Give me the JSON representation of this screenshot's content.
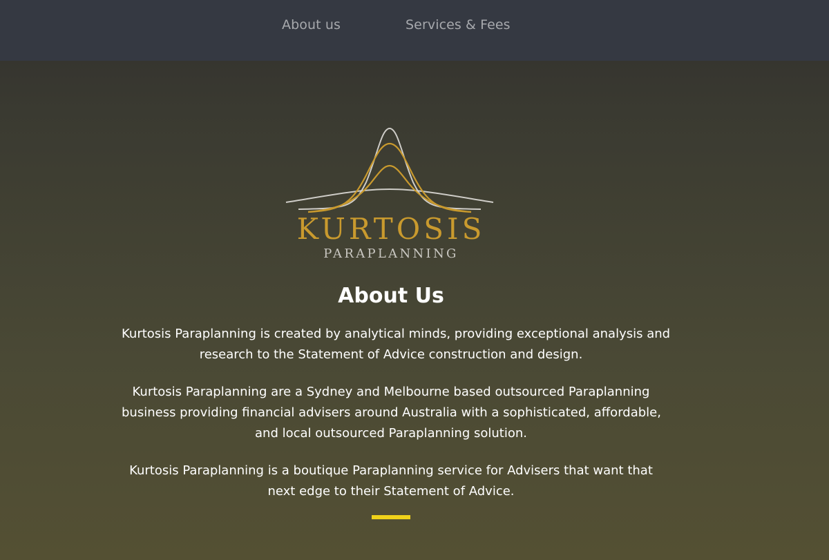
{
  "nav": {
    "items": [
      {
        "label": "About us"
      },
      {
        "label": "Services & Fees"
      }
    ]
  },
  "logo": {
    "wordmark": "KURTOSIS",
    "subtitle": "PARAPLANNING",
    "colors": {
      "gold": "#c99a2e",
      "silver": "#cfcdc8"
    }
  },
  "about": {
    "heading": "About Us",
    "paragraphs": [
      {
        "lines": [
          "Kurtosis Paraplanning is created by analytical minds, providing exceptional analysis and",
          "research to the Statement of Advice construction and design."
        ]
      },
      {
        "lines": [
          "Kurtosis Paraplanning are a Sydney and Melbourne based outsourced Paraplanning",
          "business providing financial advisers around Australia with a sophisticated, affordable,",
          "and local outsourced Paraplanning solution."
        ]
      },
      {
        "lines": [
          "Kurtosis Paraplanning is a boutique Paraplanning service for Advisers that want that",
          "next edge to their Statement of Advice."
        ]
      }
    ]
  },
  "colors": {
    "nav_bg": "#353942",
    "nav_text": "#a7a9ad",
    "accent": "#f0d21a"
  }
}
